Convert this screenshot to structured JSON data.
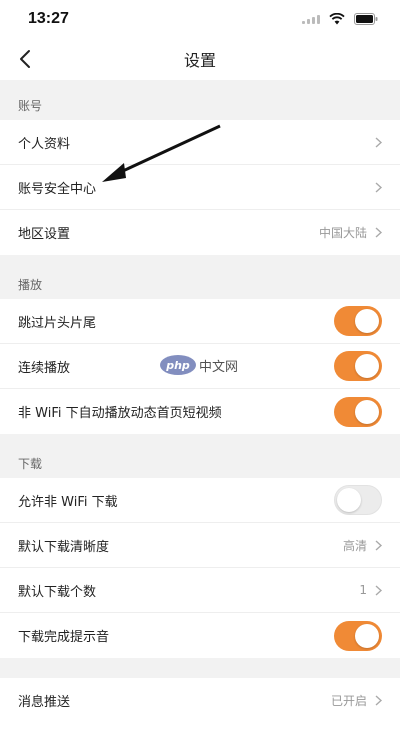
{
  "status_bar": {
    "time": "13:27"
  },
  "nav": {
    "title": "设置"
  },
  "sections": {
    "account": {
      "header": "账号",
      "rows": [
        {
          "label": "个人资料",
          "value": ""
        },
        {
          "label": "账号安全中心",
          "value": ""
        },
        {
          "label": "地区设置",
          "value": "中国大陆"
        }
      ]
    },
    "playback": {
      "header": "播放",
      "rows": [
        {
          "label": "跳过片头片尾",
          "toggle": true
        },
        {
          "label": "连续播放",
          "toggle": true
        },
        {
          "label": "非 WiFi 下自动播放动态首页短视频",
          "toggle": true
        }
      ]
    },
    "download": {
      "header": "下载",
      "rows": [
        {
          "label": "允许非 WiFi 下载",
          "toggle": false
        },
        {
          "label": "默认下载清晰度",
          "value": "高清"
        },
        {
          "label": "默认下载个数",
          "value": "1"
        },
        {
          "label": "下载完成提示音",
          "toggle": true
        }
      ]
    },
    "notifications": {
      "rows": [
        {
          "label": "消息推送",
          "value": "已开启"
        }
      ]
    }
  },
  "watermark": {
    "logo": "php",
    "text": "中文网"
  },
  "colors": {
    "accent": "#f08a36",
    "section_bg": "#f2f2f2"
  }
}
